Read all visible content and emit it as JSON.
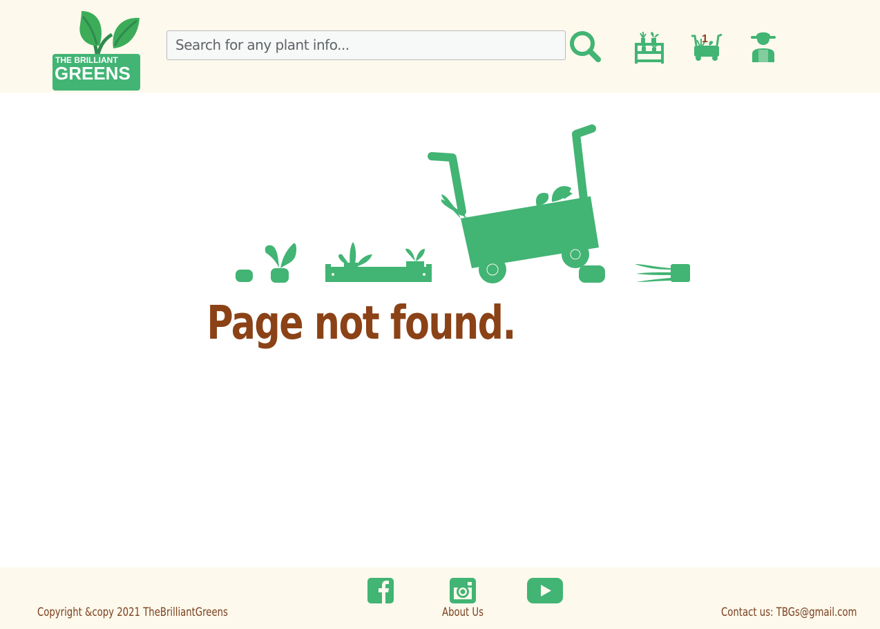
{
  "header": {
    "logo": {
      "line1": "THE BRILLIANT",
      "line2": "GREENS"
    },
    "search": {
      "placeholder": "Search for any plant info...",
      "value": ""
    },
    "icons": [
      "search-icon",
      "plant-shelf-icon",
      "plant-cart-icon",
      "gardener-user-icon"
    ],
    "cart_count": "1"
  },
  "main": {
    "title": "Page not found."
  },
  "footer": {
    "copyright": "Copyright &copy 2021 TheBrilliantGreens",
    "about": "About Us",
    "contact": "Contact us: TBGs@gmail.com",
    "social": [
      "facebook-icon",
      "instagram-icon",
      "youtube-icon"
    ]
  },
  "colors": {
    "brand_green": "#42b474",
    "header_bg": "#fdf9ec",
    "title_brown": "#8b4216",
    "footer_text": "#7a3e1e"
  }
}
